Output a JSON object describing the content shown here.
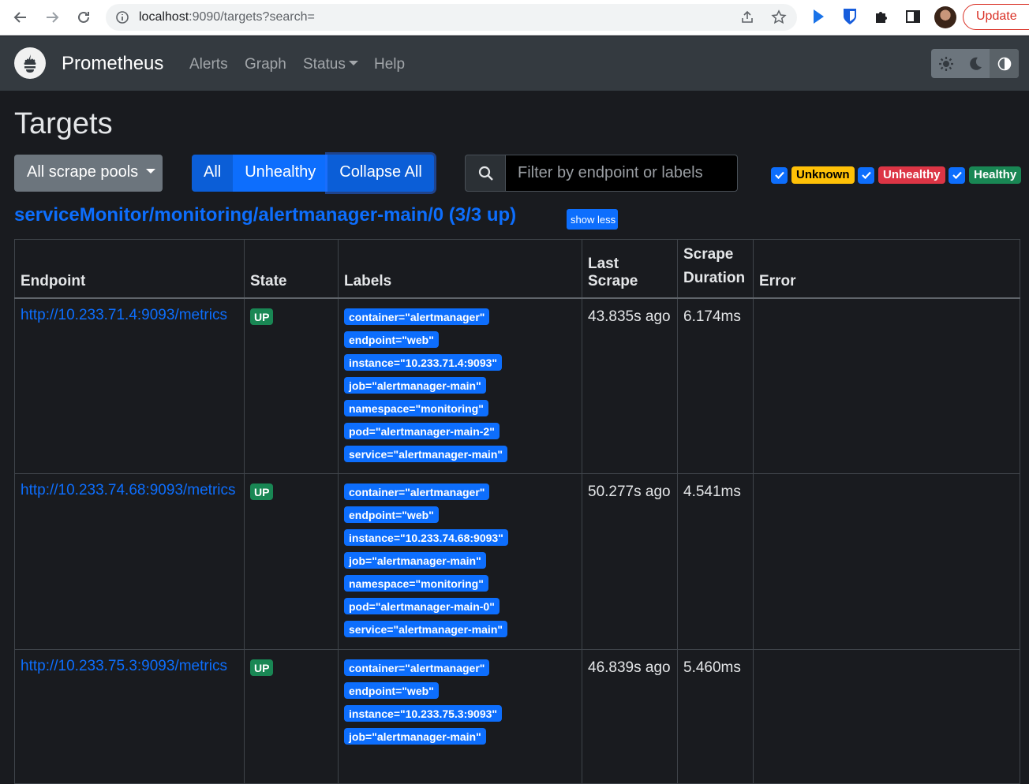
{
  "browser": {
    "url_host": "localhost",
    "url_rest": ":9090/targets?search=",
    "update_label": "Update"
  },
  "navbar": {
    "brand": "Prometheus",
    "links": [
      "Alerts",
      "Graph",
      "Status",
      "Help"
    ]
  },
  "page": {
    "title": "Targets",
    "pool_dropdown_label": "All scrape pools",
    "buttons": {
      "all": "All",
      "unhealthy": "Unhealthy",
      "collapse": "Collapse All"
    },
    "search_placeholder": "Filter by endpoint or labels",
    "filters": [
      {
        "label": "Unknown",
        "color": "#ffc107",
        "text_color": "#000000"
      },
      {
        "label": "Unhealthy",
        "color": "#dc3545",
        "text_color": "#ffffff"
      },
      {
        "label": "Healthy",
        "color": "#198754",
        "text_color": "#ffffff"
      }
    ]
  },
  "pool": {
    "title": "serviceMonitor/monitoring/alertmanager-main/0 (3/3 up)",
    "show_less_label": "show less",
    "columns": [
      "Endpoint",
      "State",
      "Labels",
      "Last Scrape",
      "Scrape Duration",
      "Error"
    ],
    "rows": [
      {
        "endpoint": "http://10.233.71.4:9093/metrics",
        "state": "UP",
        "labels": [
          {
            "k": "container",
            "v": "\"alertmanager\""
          },
          {
            "k": "endpoint",
            "v": "\"web\""
          },
          {
            "k": "instance",
            "v": "\"10.233.71.4:9093\""
          },
          {
            "k": "job",
            "v": "\"alertmanager-main\""
          },
          {
            "k": "namespace",
            "v": "\"monitoring\""
          },
          {
            "k": "pod",
            "v": "\"alertmanager-main-2\""
          },
          {
            "k": "service",
            "v": "\"alertmanager-main\""
          }
        ],
        "last_scrape": "43.835s ago",
        "duration": "6.174ms",
        "error": ""
      },
      {
        "endpoint": "http://10.233.74.68:9093/metrics",
        "state": "UP",
        "labels": [
          {
            "k": "container",
            "v": "\"alertmanager\""
          },
          {
            "k": "endpoint",
            "v": "\"web\""
          },
          {
            "k": "instance",
            "v": "\"10.233.74.68:9093\""
          },
          {
            "k": "job",
            "v": "\"alertmanager-main\""
          },
          {
            "k": "namespace",
            "v": "\"monitoring\""
          },
          {
            "k": "pod",
            "v": "\"alertmanager-main-0\""
          },
          {
            "k": "service",
            "v": "\"alertmanager-main\""
          }
        ],
        "last_scrape": "50.277s ago",
        "duration": "4.541ms",
        "error": ""
      },
      {
        "endpoint": "http://10.233.75.3:9093/metrics",
        "state": "UP",
        "labels": [
          {
            "k": "container",
            "v": "\"alertmanager\""
          },
          {
            "k": "endpoint",
            "v": "\"web\""
          },
          {
            "k": "instance",
            "v": "\"10.233.75.3:9093\""
          },
          {
            "k": "job",
            "v": "\"alertmanager-main\""
          }
        ],
        "last_scrape": "46.839s ago",
        "duration": "5.460ms",
        "error": ""
      }
    ]
  }
}
